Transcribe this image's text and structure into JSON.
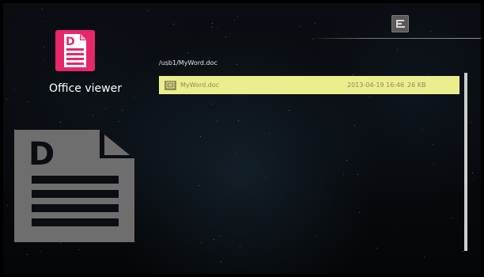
{
  "app": {
    "title": "Office viewer",
    "accent_color": "#e6276a",
    "icon": "document-icon"
  },
  "menu": {
    "icon": "menu-icon"
  },
  "browser": {
    "current_path": "/usb1/MyWord.doc",
    "files": [
      {
        "name": "MyWord.doc",
        "date": "2013-04-19 16:46",
        "size": "26 KB",
        "icon": "doc-file-icon",
        "selected": true
      }
    ],
    "highlight_color": "#ecee8e"
  },
  "preview": {
    "icon": "document-preview-icon",
    "letter": "D"
  },
  "app_icon_letter": "D"
}
